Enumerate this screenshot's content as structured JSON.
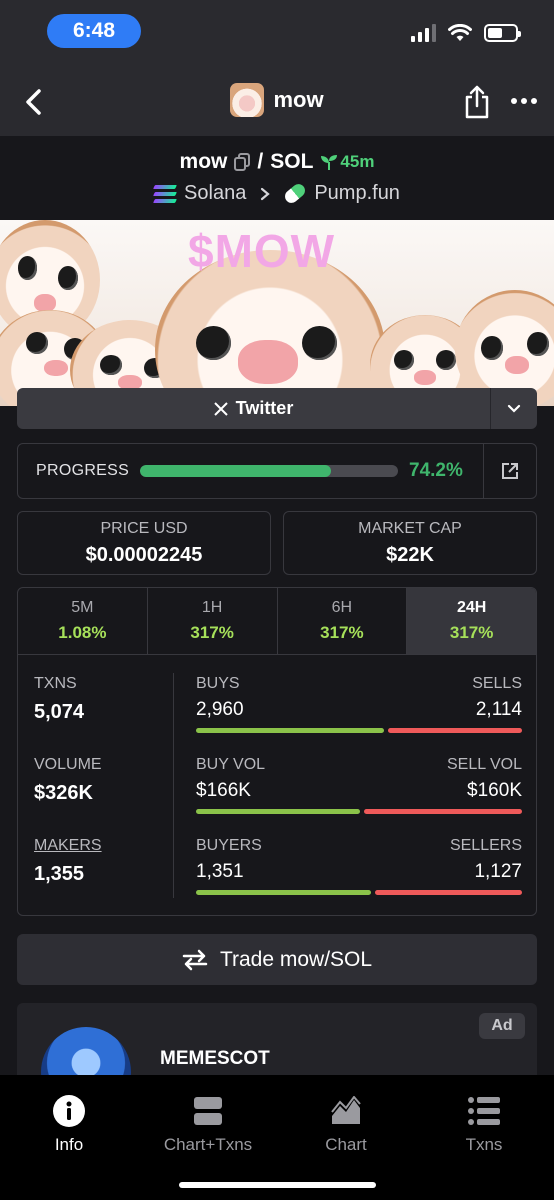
{
  "status_bar": {
    "time": "6:48"
  },
  "nav": {
    "title": "mow"
  },
  "pair": {
    "base": "mow",
    "separator": "/",
    "quote": "SOL",
    "age": "45m",
    "chain": "Solana",
    "dex": "Pump.fun"
  },
  "banner": {
    "title": "$MOW"
  },
  "socials": {
    "twitter_label": "Twitter"
  },
  "progress": {
    "label": "PROGRESS",
    "value_text": "74.2%",
    "fraction": 0.742
  },
  "price_usd": {
    "label": "PRICE USD",
    "value": "$0.00002245"
  },
  "market_cap": {
    "label": "MARKET CAP",
    "value": "$22K"
  },
  "timeframes": [
    {
      "label": "5M",
      "change": "1.08%"
    },
    {
      "label": "1H",
      "change": "317%"
    },
    {
      "label": "6H",
      "change": "317%"
    },
    {
      "label": "24H",
      "change": "317%",
      "active": true
    }
  ],
  "metrics": {
    "txns": {
      "label": "TXNS",
      "value": "5,074"
    },
    "volume": {
      "label": "VOLUME",
      "value": "$326K"
    },
    "makers": {
      "label": "MAKERS",
      "value": "1,355"
    },
    "buys": {
      "left_label": "BUYS",
      "right_label": "SELLS",
      "left_value": "2,960",
      "right_value": "2,114",
      "buy_fraction": 0.583
    },
    "vol": {
      "left_label": "BUY VOL",
      "right_label": "SELL VOL",
      "left_value": "$166K",
      "right_value": "$160K",
      "buy_fraction": 0.509
    },
    "buyers": {
      "left_label": "BUYERS",
      "right_label": "SELLERS",
      "left_value": "1,351",
      "right_value": "1,127",
      "buy_fraction": 0.545
    }
  },
  "trade": {
    "label": "Trade mow/SOL"
  },
  "ad": {
    "badge": "Ad",
    "name": "MEMESCOT"
  },
  "tabs": [
    {
      "label": "Info",
      "icon": "info-icon",
      "active": true
    },
    {
      "label": "Chart+Txns",
      "icon": "split-icon"
    },
    {
      "label": "Chart",
      "icon": "chart-icon"
    },
    {
      "label": "Txns",
      "icon": "list-icon"
    }
  ],
  "colors": {
    "green": "#3fb56c",
    "lime": "#a6e05a",
    "buy": "#8bc34a",
    "sell": "#ef5a5a",
    "status_pill": "#2f7cf6"
  }
}
